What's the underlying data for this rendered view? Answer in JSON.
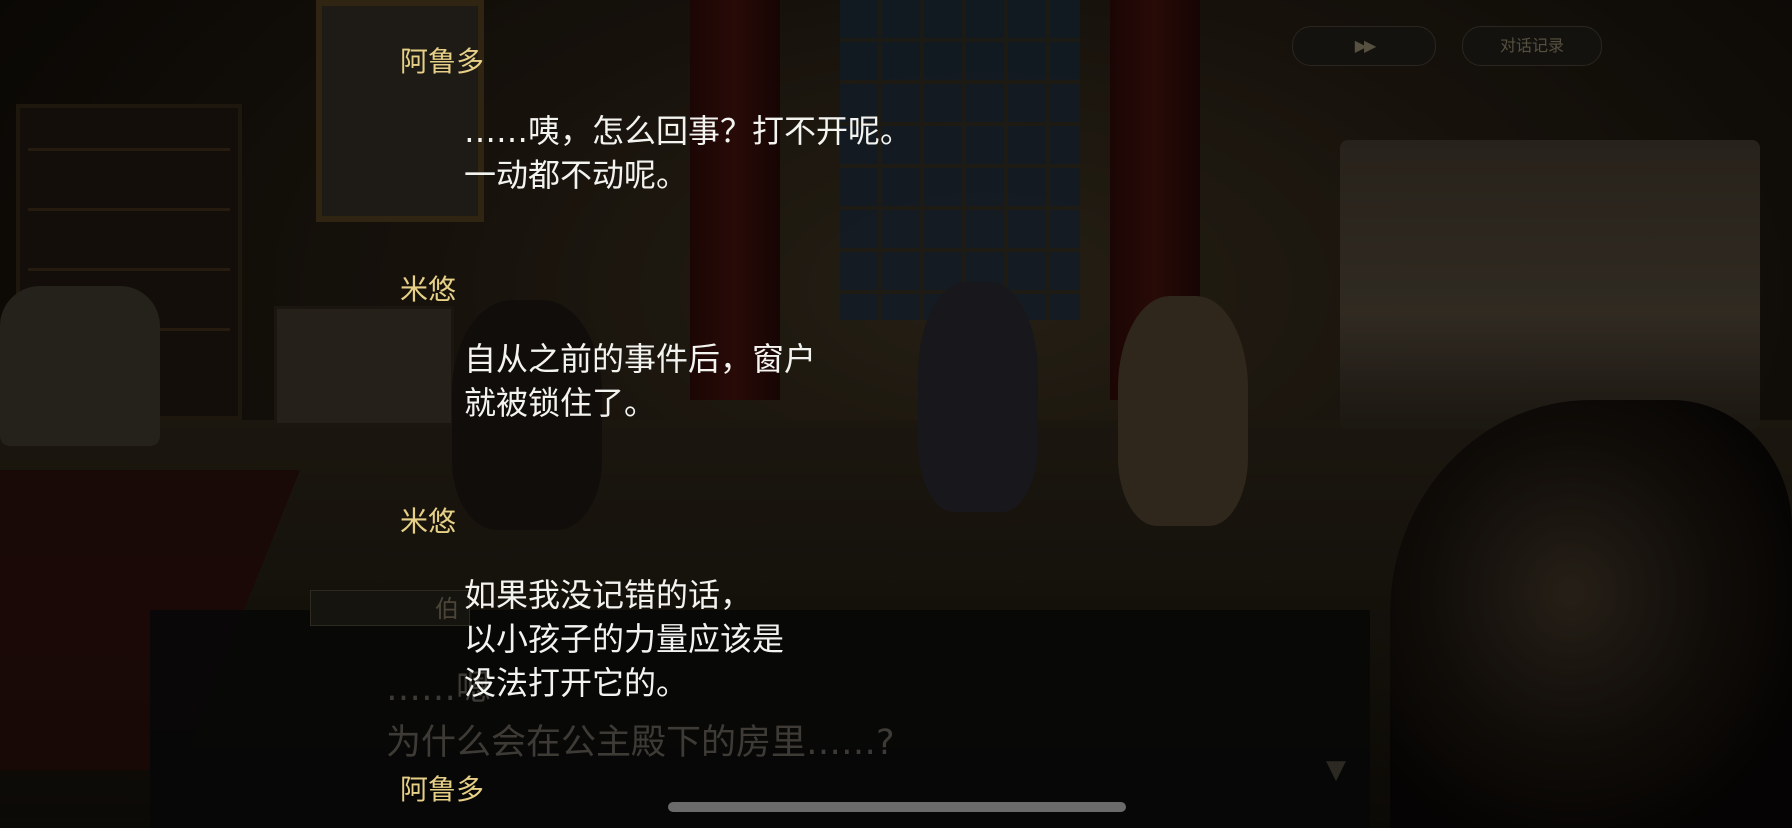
{
  "controls": {
    "auto_skip_label": "▶▶",
    "log_label": "对话记录"
  },
  "message_window": {
    "name_label": "伯",
    "line_1": "……嗯",
    "line_2": "为什么会在公主殿下的房里……?"
  },
  "backlog": [
    {
      "speaker": "阿鲁多",
      "lines": [
        "……咦，怎么回事？打不开呢。",
        "一动都不动呢。"
      ]
    },
    {
      "speaker": "米悠",
      "lines": [
        "自从之前的事件后，窗户",
        "就被锁住了。"
      ]
    },
    {
      "speaker": "米悠",
      "lines": [
        "如果我没记错的话，",
        "以小孩子的力量应该是",
        "没法打开它的。"
      ]
    },
    {
      "speaker": "阿鲁多",
      "lines": []
    }
  ],
  "colors": {
    "speaker_name": "#e6cf86",
    "dialogue_text": "#f3f3f0",
    "background": "#0d0b08"
  }
}
